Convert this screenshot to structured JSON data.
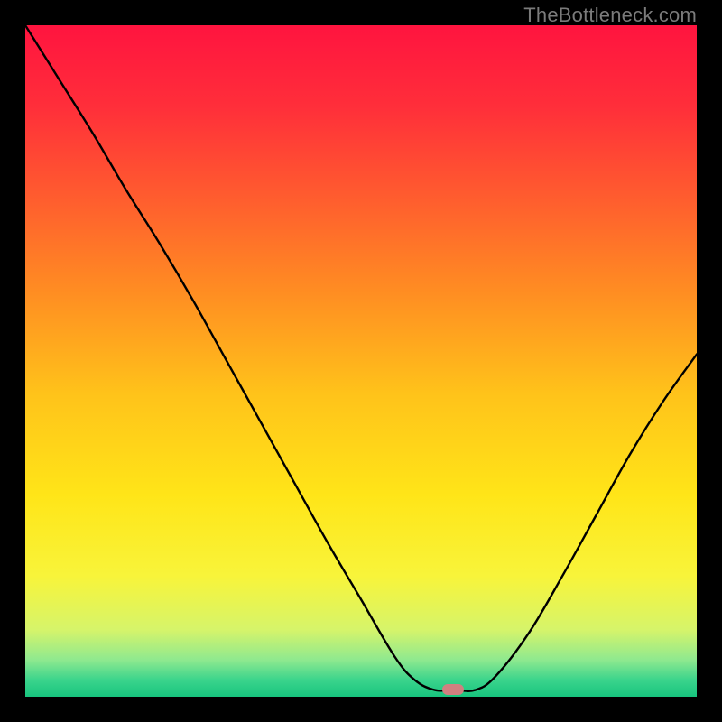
{
  "watermark": {
    "text": "TheBottleneck.com"
  },
  "marker": {
    "color": "#d18080",
    "x_frac": 0.637,
    "y_frac": 0.989
  },
  "gradient_stops": [
    {
      "offset": 0.0,
      "color": "#ff143f"
    },
    {
      "offset": 0.12,
      "color": "#ff2e3a"
    },
    {
      "offset": 0.25,
      "color": "#ff5a2f"
    },
    {
      "offset": 0.4,
      "color": "#ff8e22"
    },
    {
      "offset": 0.55,
      "color": "#ffc31a"
    },
    {
      "offset": 0.7,
      "color": "#ffe518"
    },
    {
      "offset": 0.82,
      "color": "#f8f43a"
    },
    {
      "offset": 0.9,
      "color": "#d6f46a"
    },
    {
      "offset": 0.945,
      "color": "#8fe98f"
    },
    {
      "offset": 0.975,
      "color": "#3bd48c"
    },
    {
      "offset": 1.0,
      "color": "#17c47e"
    }
  ],
  "chart_data": {
    "type": "line",
    "title": "",
    "xlabel": "",
    "ylabel": "",
    "xlim": [
      0,
      1
    ],
    "ylim": [
      0,
      1
    ],
    "grid": false,
    "legend": false,
    "series": [
      {
        "name": "curve",
        "x": [
          0.0,
          0.05,
          0.1,
          0.15,
          0.2,
          0.25,
          0.3,
          0.35,
          0.4,
          0.45,
          0.5,
          0.55,
          0.58,
          0.61,
          0.64,
          0.67,
          0.7,
          0.75,
          0.8,
          0.85,
          0.9,
          0.95,
          1.0
        ],
        "y": [
          1.0,
          0.92,
          0.84,
          0.755,
          0.675,
          0.59,
          0.5,
          0.41,
          0.32,
          0.23,
          0.145,
          0.06,
          0.025,
          0.01,
          0.01,
          0.01,
          0.03,
          0.095,
          0.18,
          0.27,
          0.36,
          0.44,
          0.51
        ]
      }
    ]
  }
}
